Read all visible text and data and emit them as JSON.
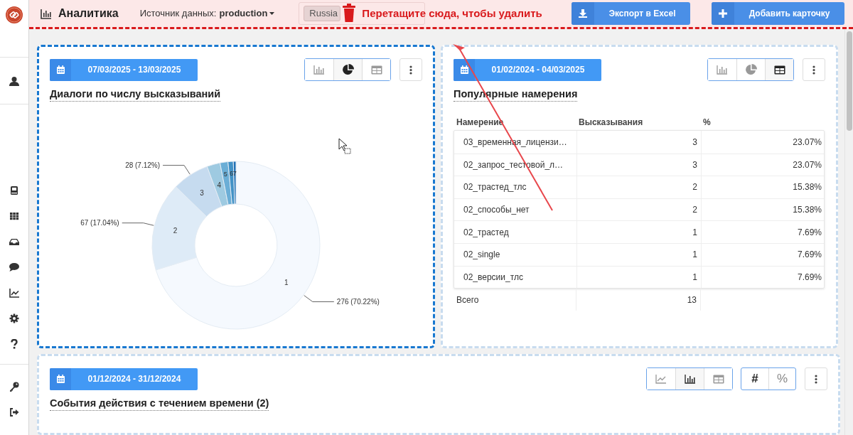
{
  "header": {
    "title": "Аналитика",
    "source_label": "Источник данных:",
    "source_value": "production"
  },
  "drop_zone": {
    "chip": "Russia",
    "message": "Перетащите сюда, чтобы удалить"
  },
  "header_buttons": [
    {
      "kind": "download",
      "label": "Экспорт в Excel"
    },
    {
      "kind": "plus",
      "label": "Добавить карточку"
    }
  ],
  "cards": [
    {
      "date_range": "07/03/2025 - 13/03/2025",
      "title": "Диалоги по числу высказываний",
      "dragging": true,
      "view_buttons": [
        {
          "kind": "bar",
          "selected": false
        },
        {
          "kind": "pie",
          "selected": true
        },
        {
          "kind": "table",
          "selected": false
        }
      ],
      "chart_data": {
        "type": "donut",
        "categories": [
          "1",
          "2",
          "3",
          "4",
          "5",
          "6",
          "7"
        ],
        "values": [
          276,
          67,
          28,
          10,
          6,
          4,
          2
        ],
        "value_labels": [
          "276 (70.22%)",
          "67 (17.04%)",
          "28 (7.12%)",
          null,
          null,
          null,
          null
        ]
      }
    },
    {
      "date_range": "01/02/2024 - 04/03/2025",
      "title": "Популярные намерения",
      "dragging": false,
      "view_buttons": [
        {
          "kind": "bar",
          "selected": false
        },
        {
          "kind": "pie",
          "selected": false
        },
        {
          "kind": "table",
          "selected": true
        }
      ],
      "table": {
        "columns": [
          "Намерение",
          "Высказывания",
          "%"
        ],
        "rows": [
          [
            "03_временная_лицензи…",
            "3",
            "23.07%"
          ],
          [
            "02_запрос_тестовой_л…",
            "3",
            "23.07%"
          ],
          [
            "02_трастед_тлс",
            "2",
            "15.38%"
          ],
          [
            "02_способы_нет",
            "2",
            "15.38%"
          ],
          [
            "02_трастед",
            "1",
            "7.69%"
          ],
          [
            "02_single",
            "1",
            "7.69%"
          ],
          [
            "02_версии_тлс",
            "1",
            "7.69%"
          ]
        ],
        "total": {
          "label": "Всего",
          "value": "13"
        }
      }
    },
    {
      "date_range": "01/12/2024 - 31/12/2024",
      "title": "События действия с течением времени (2)",
      "dragging": false,
      "view_buttons": [
        {
          "kind": "line",
          "selected": false
        },
        {
          "kind": "bar",
          "selected": true
        },
        {
          "kind": "table",
          "selected": false
        }
      ],
      "mode_buttons": [
        {
          "label": "#",
          "selected": true
        },
        {
          "label": "%",
          "selected": false
        }
      ]
    }
  ]
}
